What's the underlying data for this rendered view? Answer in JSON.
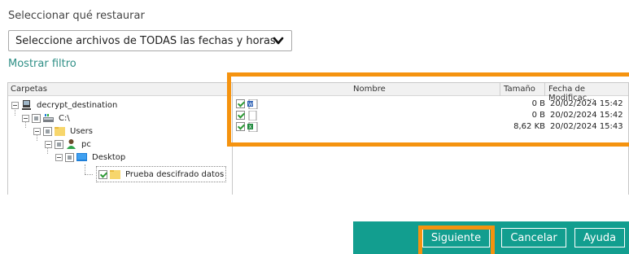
{
  "restore": {
    "label": "Seleccionar qué restaurar",
    "select_value": "Seleccione archivos de TODAS las fechas y horas",
    "show_filter": "Mostrar filtro"
  },
  "tree": {
    "header": "Carpetas",
    "nodes": [
      {
        "label": "decrypt_destination",
        "icon": "computer-icon"
      },
      {
        "label": "C:\\",
        "icon": "drive-icon"
      },
      {
        "label": "Users",
        "icon": "folder-icon"
      },
      {
        "label": "pc",
        "icon": "user-icon"
      },
      {
        "label": "Desktop",
        "icon": "desktop-folder-icon"
      },
      {
        "label": "Prueba descifrado datos",
        "icon": "folder-icon"
      }
    ]
  },
  "files": {
    "columns": [
      "Nombre",
      "Tamaño",
      "Fecha de Modificac..."
    ],
    "rows": [
      {
        "name": "",
        "size": "0 B",
        "date": "20/02/2024 15:42",
        "icon": "word-doc-icon"
      },
      {
        "name": "",
        "size": "0 B",
        "date": "20/02/2024 15:42",
        "icon": "blank-doc-icon"
      },
      {
        "name": "",
        "size": "8,62 KB",
        "date": "20/02/2024 15:43",
        "icon": "excel-doc-icon"
      }
    ]
  },
  "buttons": {
    "next": "Siguiente",
    "cancel": "Cancelar",
    "help": "Ayuda"
  },
  "colors": {
    "accent": "#129e8f",
    "link": "#2f8f86",
    "highlight": "#f5930f",
    "check": "#2e9a35"
  }
}
